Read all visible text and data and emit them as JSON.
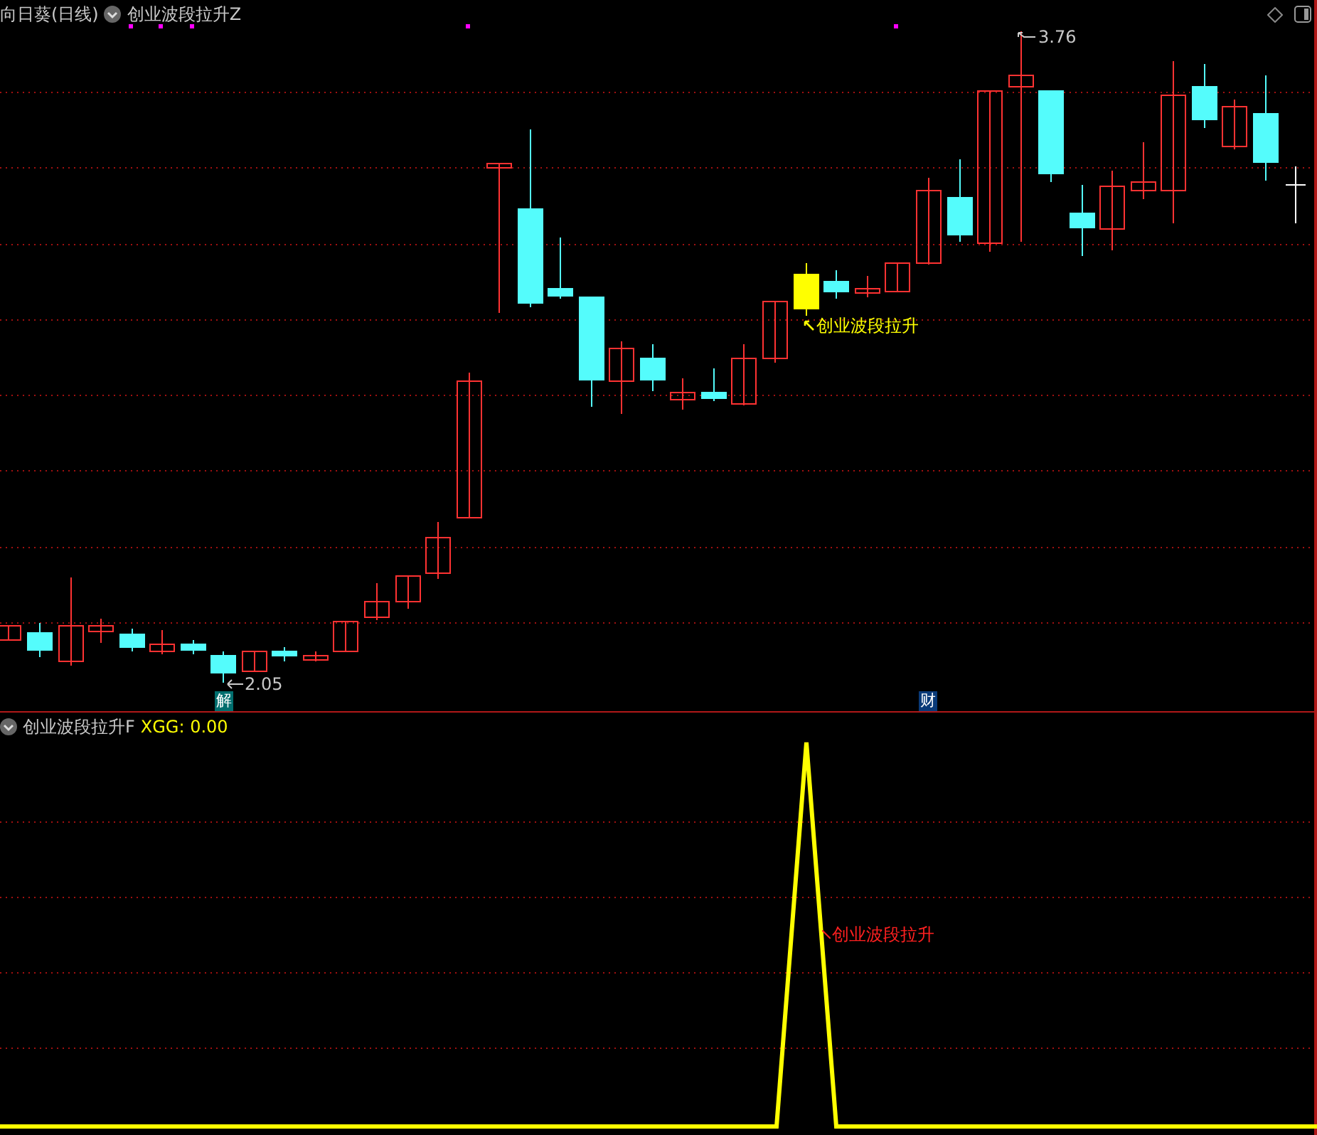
{
  "main_panel": {
    "security": "向日葵(日线)",
    "indicator": "创业波段拉升Z",
    "high_label": "3.76",
    "low_label": "2.05",
    "signal_label": "创业波段拉升",
    "markers": [
      {
        "label": "解",
        "color": "#006e6e"
      },
      {
        "label": "财",
        "color": "#0a3a78"
      }
    ]
  },
  "sub_panel": {
    "indicator": "创业波段拉升F",
    "reading": "XGG: 0.00",
    "signal_label": "创业波段拉升"
  }
}
